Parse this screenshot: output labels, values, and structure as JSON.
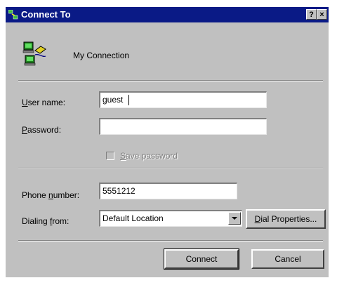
{
  "window": {
    "title": "Connect To",
    "help_label": "?",
    "close_label": "×"
  },
  "connection": {
    "name": "My Connection",
    "icon": "modem-network-icon"
  },
  "form": {
    "username_label_hot": "U",
    "username_label_rest": "ser name:",
    "username_value": "guest",
    "password_label_hot": "P",
    "password_label_rest": "assword:",
    "password_value": "",
    "save_password_hot": "S",
    "save_password_rest": "ave password",
    "phone_label_pre": "Phone ",
    "phone_label_hot": "n",
    "phone_label_rest": "umber:",
    "phone_value": "5551212",
    "dialing_label_pre": "Dialing ",
    "dialing_label_hot": "f",
    "dialing_label_rest": "rom:",
    "dialing_value": "Default Location"
  },
  "buttons": {
    "dial_properties_hot": "D",
    "dial_properties_rest": "ial Properties...",
    "connect": "Connect",
    "cancel": "Cancel"
  }
}
